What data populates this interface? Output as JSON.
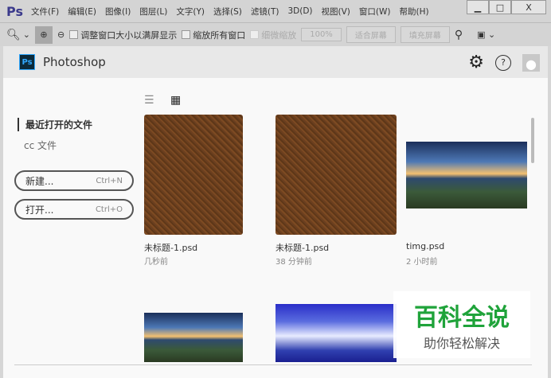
{
  "menubar": {
    "logo": "Ps",
    "items": [
      "文件(F)",
      "编辑(E)",
      "图像(I)",
      "图层(L)",
      "文字(Y)",
      "选择(S)",
      "滤镜(T)",
      "3D(D)",
      "视图(V)",
      "窗口(W)",
      "帮助(H)"
    ]
  },
  "window": {
    "minimize": "▁",
    "maximize": "□",
    "close": "X"
  },
  "toolbar": {
    "resize_windows": "调整窗口大小以满屏显示",
    "zoom_all": "缩放所有窗口",
    "scrubby": "细微缩放",
    "zoom_level": "100%",
    "fit_screen": "适合屏幕",
    "fill_screen": "填充屏幕"
  },
  "header": {
    "logo": "Ps",
    "title": "Photoshop"
  },
  "sidebar": {
    "recent": "最近打开的文件",
    "cc": "cc 文件",
    "new_label": "新建...",
    "new_shortcut": "Ctrl+N",
    "open_label": "打开...",
    "open_shortcut": "Ctrl+O"
  },
  "files": [
    {
      "name": "未标题-1.psd",
      "time": "几秒前"
    },
    {
      "name": "未标题-1.psd",
      "time": "38 分钟前"
    },
    {
      "name": "timg.psd",
      "time": "2 小时前"
    }
  ],
  "watermark": {
    "title": "百科全说",
    "subtitle": "助你轻松解决"
  }
}
